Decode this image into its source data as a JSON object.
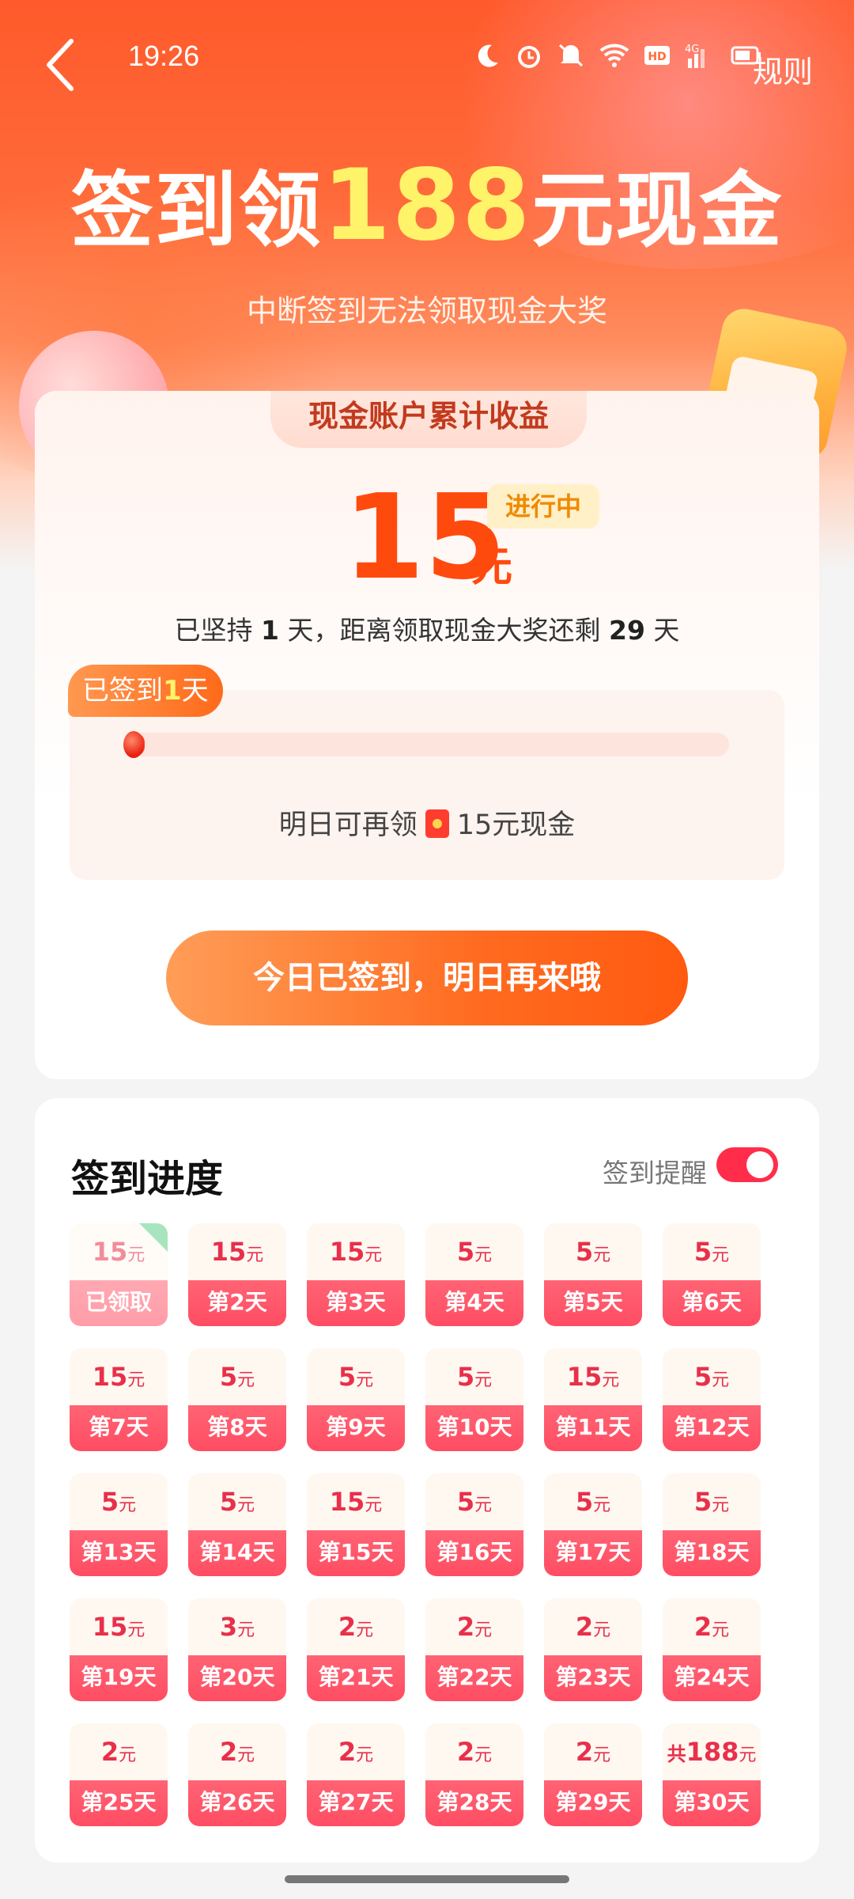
{
  "status": {
    "time": "19:26",
    "icons": [
      "moon-icon",
      "alarm-icon",
      "mute-icon",
      "wifi-icon",
      "hd-icon",
      "signal-4g-icon",
      "battery-icon"
    ]
  },
  "header": {
    "rules_label": "规则",
    "title_prefix": "签到领",
    "title_amount": "188",
    "title_suffix": "元现金",
    "subtitle": "中断签到无法领取现金大奖"
  },
  "summary": {
    "tab_label": "现金账户累计收益",
    "amount": "15",
    "unit": "元",
    "status_badge": "进行中",
    "persist_prefix": "已坚持 ",
    "persist_days": "1",
    "persist_middle": " 天，距离领取现金大奖还剩 ",
    "remaining_days": "29",
    "persist_suffix": " 天",
    "bubble_prefix": "已签到",
    "bubble_days": "1",
    "bubble_suffix": "天",
    "progress_fraction": 0.033,
    "tomorrow_prefix": "明日可再领",
    "tomorrow_reward": "15元现金",
    "cta_label": "今日已签到，明日再来哦"
  },
  "progress_section": {
    "title": "签到进度",
    "reminder_label": "签到提醒",
    "reminder_on": true,
    "unit": "元",
    "days": [
      {
        "amount": "15",
        "label": "已领取",
        "claimed": true
      },
      {
        "amount": "15",
        "label": "第2天"
      },
      {
        "amount": "15",
        "label": "第3天"
      },
      {
        "amount": "5",
        "label": "第4天"
      },
      {
        "amount": "5",
        "label": "第5天"
      },
      {
        "amount": "5",
        "label": "第6天"
      },
      {
        "amount": "15",
        "label": "第7天"
      },
      {
        "amount": "5",
        "label": "第8天"
      },
      {
        "amount": "5",
        "label": "第9天"
      },
      {
        "amount": "5",
        "label": "第10天"
      },
      {
        "amount": "15",
        "label": "第11天"
      },
      {
        "amount": "5",
        "label": "第12天"
      },
      {
        "amount": "5",
        "label": "第13天"
      },
      {
        "amount": "5",
        "label": "第14天"
      },
      {
        "amount": "15",
        "label": "第15天"
      },
      {
        "amount": "5",
        "label": "第16天"
      },
      {
        "amount": "5",
        "label": "第17天"
      },
      {
        "amount": "5",
        "label": "第18天"
      },
      {
        "amount": "15",
        "label": "第19天"
      },
      {
        "amount": "3",
        "label": "第20天"
      },
      {
        "amount": "2",
        "label": "第21天"
      },
      {
        "amount": "2",
        "label": "第22天"
      },
      {
        "amount": "2",
        "label": "第23天"
      },
      {
        "amount": "2",
        "label": "第24天"
      },
      {
        "amount": "2",
        "label": "第25天"
      },
      {
        "amount": "2",
        "label": "第26天"
      },
      {
        "amount": "2",
        "label": "第27天"
      },
      {
        "amount": "2",
        "label": "第28天"
      },
      {
        "amount": "2",
        "label": "第29天"
      },
      {
        "amount": "188",
        "label": "第30天",
        "prefix": "共"
      }
    ]
  },
  "colors": {
    "accent": "#ff4a0e",
    "highlight": "#fff36a",
    "cell_red": "#ff4d63",
    "toggle_on": "#ff2d4a"
  }
}
